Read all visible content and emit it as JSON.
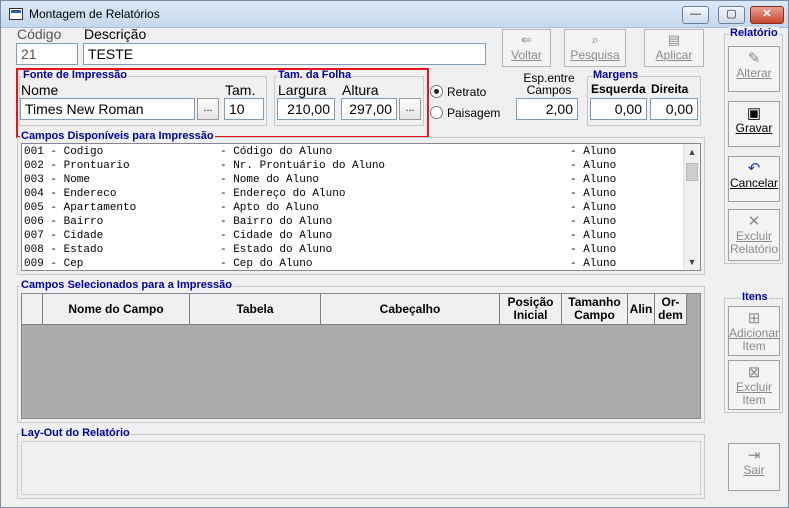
{
  "window": {
    "title": "Montagem de Relatórios"
  },
  "window_controls": {
    "minimize": "—",
    "maximize": "▢",
    "close": "✕"
  },
  "header": {
    "codigo_label": "Código",
    "codigo_value": "21",
    "descricao_label": "Descrição",
    "descricao_value": "TESTE"
  },
  "toolbar": {
    "voltar": "Voltar",
    "pesquisa": "Pesquisa",
    "aplicar": "Aplicar"
  },
  "fonte": {
    "group_title": "Fonte de Impressão",
    "nome_label": "Nome",
    "nome_value": "Times New Roman",
    "tam_label": "Tam.",
    "tam_value": "10",
    "browse": "..."
  },
  "folha": {
    "group_title": "Tam. da Folha",
    "largura_label": "Largura",
    "largura_value": "210,00",
    "altura_label": "Altura",
    "altura_value": "297,00",
    "browse": "..."
  },
  "orientacao": {
    "retrato": "Retrato",
    "paisagem": "Paisagem",
    "selected": "Retrato"
  },
  "espacamento": {
    "label_line1": "Esp.entre",
    "label_line2": "Campos",
    "value": "2,00"
  },
  "margens": {
    "group_title": "Margens",
    "esquerda_label": "Esquerda",
    "esquerda_value": "0,00",
    "direita_label": "Direita",
    "direita_value": "0,00"
  },
  "campos_disponiveis": {
    "group_title": "Campos Disponíveis para Impressão",
    "rows": [
      {
        "code": "001 - Codigo",
        "desc": "- Código do Aluno",
        "tab": "- Aluno"
      },
      {
        "code": "002 - Prontuario",
        "desc": "- Nr. Prontuário do Aluno",
        "tab": "- Aluno"
      },
      {
        "code": "003 - Nome",
        "desc": "- Nome do Aluno",
        "tab": "- Aluno"
      },
      {
        "code": "004 - Endereco",
        "desc": "- Endereço do Aluno",
        "tab": "- Aluno"
      },
      {
        "code": "005 - Apartamento",
        "desc": "- Apto do Aluno",
        "tab": "- Aluno"
      },
      {
        "code": "006 - Bairro",
        "desc": "- Bairro do Aluno",
        "tab": "- Aluno"
      },
      {
        "code": "007 - Cidade",
        "desc": "- Cidade do Aluno",
        "tab": "- Aluno"
      },
      {
        "code": "008 - Estado",
        "desc": "- Estado do Aluno",
        "tab": "- Aluno"
      },
      {
        "code": "009 - Cep",
        "desc": "- Cep do Aluno",
        "tab": "- Aluno"
      }
    ]
  },
  "campos_selecionados": {
    "group_title": "Campos Selecionados para a Impressão",
    "columns": [
      "Nome do Campo",
      "Tabela",
      "Cabeçalho",
      "Posição Inicial",
      "Tamanho Campo",
      "Alin",
      "Or- dem"
    ]
  },
  "layout_section": {
    "group_title": "Lay-Out do Relatório"
  },
  "relatorio_panel": {
    "group_title": "Relatório",
    "alterar": "Alterar",
    "gravar": "Gravar",
    "cancelar": "Cancelar",
    "excluir_line1": "Excluir",
    "excluir_line2": "Relatório"
  },
  "itens_panel": {
    "group_title": "Itens",
    "adicionar_line1": "Adicionar",
    "adicionar_line2": "Item",
    "excluir_line1": "Excluir",
    "excluir_line2": "Item"
  },
  "sair": "Sair",
  "colors": {
    "group_title": "#0000a0",
    "highlight": "#e8141c",
    "grid_bg": "#ababab"
  }
}
